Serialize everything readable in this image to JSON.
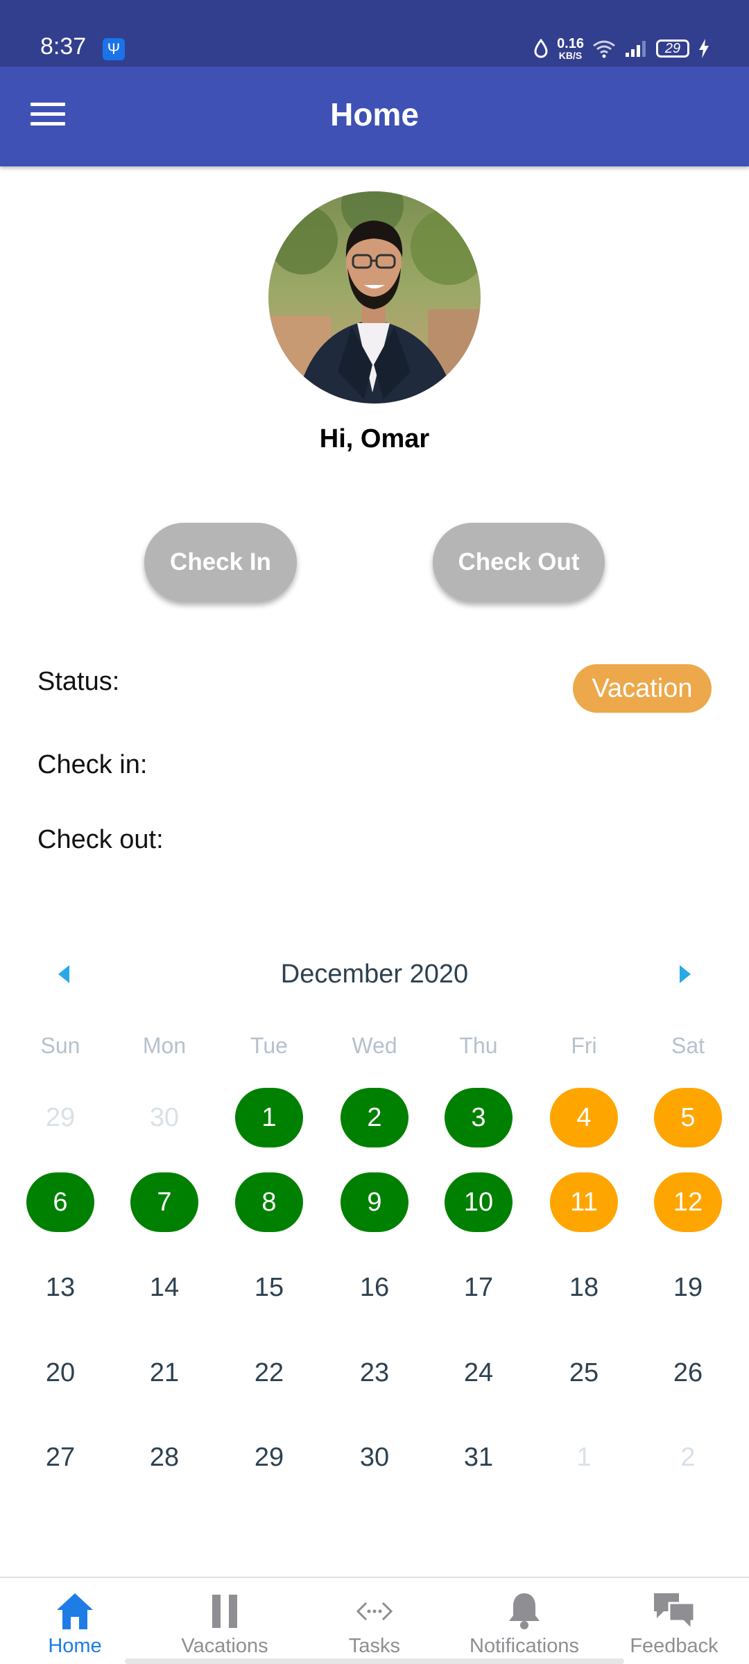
{
  "status_bar": {
    "time": "8:37",
    "usb_icon": "usb-icon",
    "net_speed_value": "0.16",
    "net_speed_unit": "KB/S",
    "battery": "29"
  },
  "app_bar": {
    "title": "Home",
    "menu_icon": "hamburger-menu-icon",
    "color": "#3f51b5"
  },
  "profile": {
    "greeting": "Hi, Omar"
  },
  "actions": {
    "check_in_label": "Check In",
    "check_out_label": "Check Out"
  },
  "info": {
    "status_label": "Status:",
    "status_value": "Vacation",
    "check_in_label": "Check in:",
    "check_out_label": "Check out:"
  },
  "calendar": {
    "month_label": "December 2020",
    "weekdays": [
      "Sun",
      "Mon",
      "Tue",
      "Wed",
      "Thu",
      "Fri",
      "Sat"
    ],
    "weeks": [
      [
        {
          "d": "29",
          "s": "other"
        },
        {
          "d": "30",
          "s": "other"
        },
        {
          "d": "1",
          "s": "present"
        },
        {
          "d": "2",
          "s": "present"
        },
        {
          "d": "3",
          "s": "present"
        },
        {
          "d": "4",
          "s": "vacation"
        },
        {
          "d": "5",
          "s": "vacation"
        }
      ],
      [
        {
          "d": "6",
          "s": "present"
        },
        {
          "d": "7",
          "s": "present"
        },
        {
          "d": "8",
          "s": "present"
        },
        {
          "d": "9",
          "s": "present"
        },
        {
          "d": "10",
          "s": "present"
        },
        {
          "d": "11",
          "s": "vacation"
        },
        {
          "d": "12",
          "s": "vacation"
        }
      ],
      [
        {
          "d": "13",
          "s": ""
        },
        {
          "d": "14",
          "s": ""
        },
        {
          "d": "15",
          "s": ""
        },
        {
          "d": "16",
          "s": ""
        },
        {
          "d": "17",
          "s": ""
        },
        {
          "d": "18",
          "s": ""
        },
        {
          "d": "19",
          "s": ""
        }
      ],
      [
        {
          "d": "20",
          "s": ""
        },
        {
          "d": "21",
          "s": ""
        },
        {
          "d": "22",
          "s": ""
        },
        {
          "d": "23",
          "s": ""
        },
        {
          "d": "24",
          "s": ""
        },
        {
          "d": "25",
          "s": ""
        },
        {
          "d": "26",
          "s": ""
        }
      ],
      [
        {
          "d": "27",
          "s": ""
        },
        {
          "d": "28",
          "s": ""
        },
        {
          "d": "29",
          "s": ""
        },
        {
          "d": "30",
          "s": ""
        },
        {
          "d": "31",
          "s": ""
        },
        {
          "d": "1",
          "s": "other"
        },
        {
          "d": "2",
          "s": "other"
        }
      ]
    ],
    "colors": {
      "present": "#008000",
      "vacation": "#ffa500",
      "arrow": "#29a9e6"
    }
  },
  "bottom_nav": {
    "items": [
      {
        "label": "Home",
        "icon": "home-icon",
        "active": true
      },
      {
        "label": "Vacations",
        "icon": "pause-icon",
        "active": false
      },
      {
        "label": "Tasks",
        "icon": "code-arrows-icon",
        "active": false
      },
      {
        "label": "Notifications",
        "icon": "bell-icon",
        "active": false
      },
      {
        "label": "Feedback",
        "icon": "chat-bubbles-icon",
        "active": false
      }
    ],
    "active_color": "#1e7ce6",
    "inactive_color": "#8e8e93"
  }
}
